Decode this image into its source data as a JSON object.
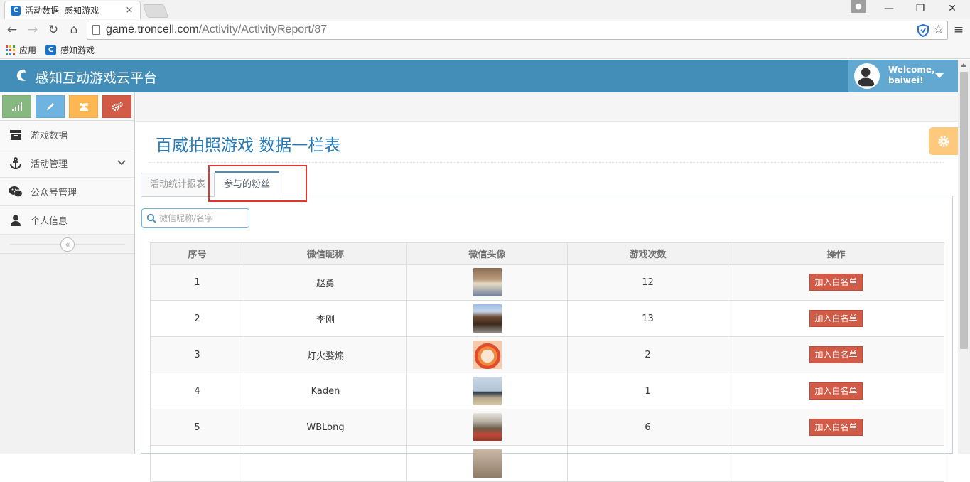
{
  "browser": {
    "tab_title": "活动数据 -感知游戏",
    "tab_close": "×",
    "url_host": "game.troncell.com",
    "url_path": "/Activity/ActivityReport/87",
    "bookmarks": [
      {
        "label": "应用",
        "icon": "apps-grid-icon"
      },
      {
        "label": "感知游戏",
        "icon": "site-favicon"
      }
    ],
    "window_buttons": {
      "minimize": "—",
      "maximize": "❐",
      "close": "✕"
    }
  },
  "header": {
    "brand": "感知互动游戏云平台",
    "welcome_line1": "Welcome,",
    "welcome_line2": "baiwei!",
    "color": "#438eb9"
  },
  "sidebar": {
    "shortcuts": [
      {
        "name": "signal",
        "color": "#87b87f"
      },
      {
        "name": "pencil",
        "color": "#6fb3e0"
      },
      {
        "name": "group",
        "color": "#ffb752"
      },
      {
        "name": "cogs",
        "color": "#d15b47"
      }
    ],
    "items": [
      {
        "label": "游戏数据",
        "icon": "archive-icon"
      },
      {
        "label": "活动管理",
        "icon": "anchor-icon",
        "has_submenu": true
      },
      {
        "label": "公众号管理",
        "icon": "wechat-icon"
      },
      {
        "label": "个人信息",
        "icon": "user-icon"
      }
    ],
    "collapse_symbol": "«"
  },
  "main": {
    "title": "百威拍照游戏 数据一栏表",
    "tabs": [
      {
        "label": "活动统计报表",
        "active": false
      },
      {
        "label": "参与的粉丝",
        "active": true
      }
    ],
    "search": {
      "placeholder": "微信昵称/名字",
      "value": ""
    },
    "table": {
      "headers": [
        "序号",
        "微信昵称",
        "微信头像",
        "游戏次数",
        "操作"
      ],
      "rows": [
        {
          "index": "1",
          "nickname": "赵勇",
          "plays": "12",
          "action": "加入白名单"
        },
        {
          "index": "2",
          "nickname": "李刚",
          "plays": "13",
          "action": "加入白名单"
        },
        {
          "index": "3",
          "nickname": "灯火婺煽",
          "plays": "2",
          "action": "加入白名单"
        },
        {
          "index": "4",
          "nickname": "Kaden",
          "plays": "1",
          "action": "加入白名单"
        },
        {
          "index": "5",
          "nickname": "WBLong",
          "plays": "6",
          "action": "加入白名单"
        }
      ]
    }
  }
}
